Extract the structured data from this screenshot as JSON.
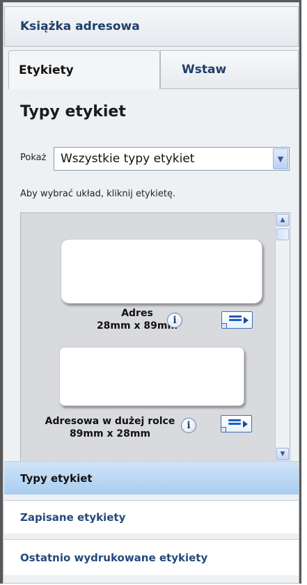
{
  "header": {
    "address_book": "Książka adresowa"
  },
  "tabs": [
    {
      "label": "Etykiety",
      "active": true
    },
    {
      "label": "Wstaw",
      "active": false
    }
  ],
  "section_title": "Typy etykiet",
  "filter": {
    "label": "Pokaż",
    "selected": "Wszystkie typy etykiet"
  },
  "hint": "Aby wybrać układ, kliknij etykietę.",
  "labels": [
    {
      "name": "Adres",
      "size": "28mm x 89mm"
    },
    {
      "name": "Adresowa w dużej rolce",
      "size": "89mm x 28mm"
    }
  ],
  "nav": [
    {
      "label": "Typy etykiet",
      "active": true
    },
    {
      "label": "Zapisane etykiety",
      "active": false
    },
    {
      "label": "Ostatnio wydrukowane etykiety",
      "active": false
    }
  ],
  "colors": {
    "accent": "#1f3e6a",
    "active_nav": "#b9d8f4",
    "layout_icon_blue": "#1f5fbf"
  },
  "icons": [
    "info-icon",
    "label-layout-icon",
    "chevron-down-icon",
    "scroll-up-icon",
    "scroll-down-icon"
  ]
}
